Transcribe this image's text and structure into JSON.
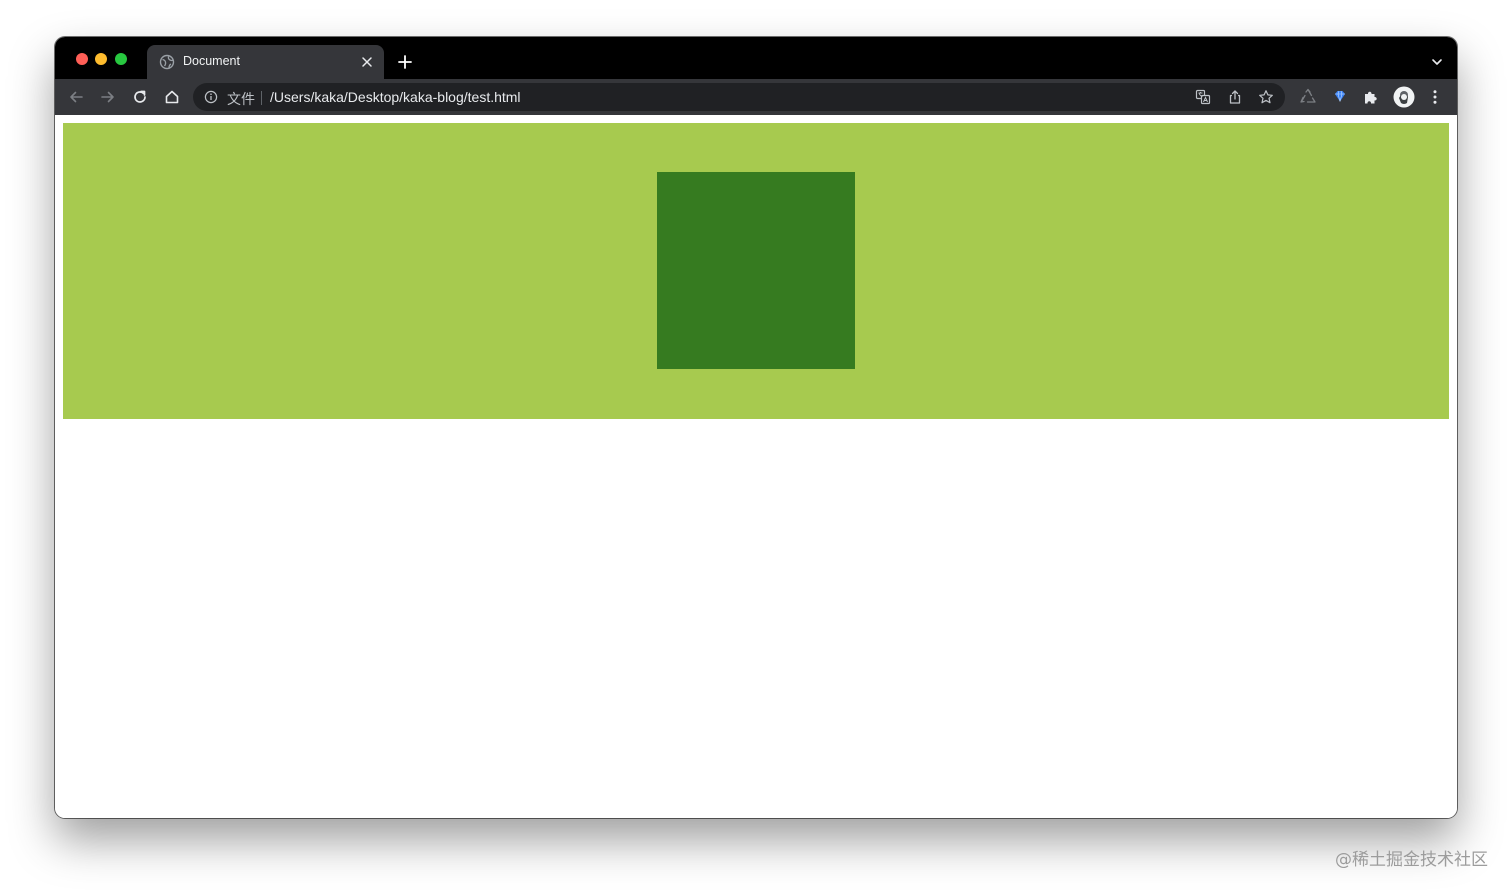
{
  "browser": {
    "tab": {
      "title": "Document"
    },
    "address_bar": {
      "scheme_label": "文件",
      "url": "/Users/kaka/Desktop/kaka-blog/test.html"
    }
  },
  "page": {
    "outer_box_color": "#a7ca4f",
    "inner_box_color": "#367b20"
  },
  "watermark": "@稀土掘金技术社区",
  "icons": [
    "globe-icon",
    "close-icon",
    "plus-icon",
    "chevron-down-icon",
    "back-arrow-icon",
    "forward-arrow-icon",
    "reload-icon",
    "home-icon",
    "info-icon",
    "translate-icon",
    "share-icon",
    "star-icon",
    "recycle-icon",
    "gem-icon",
    "puzzle-icon",
    "avatar",
    "more-vertical-icon"
  ]
}
